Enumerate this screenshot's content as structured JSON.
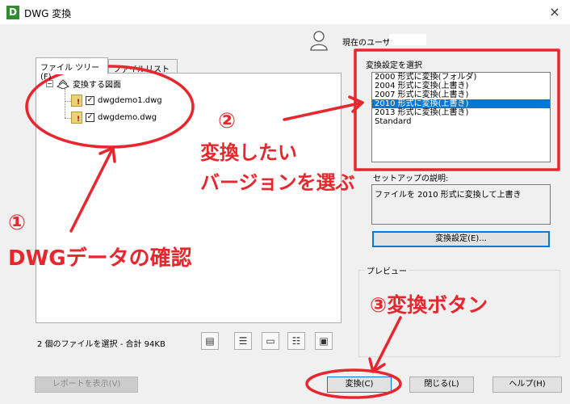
{
  "window": {
    "app_icon_letter": "D",
    "title": "DWG 変換",
    "close_glyph": "×"
  },
  "user": {
    "label": "現在のユーザ:",
    "value": ""
  },
  "tabs": [
    {
      "label": "ファイル ツリー(F)"
    },
    {
      "label": "ファイルリスト(B)"
    }
  ],
  "tree": {
    "root_label": "変換する図面",
    "files": [
      {
        "name": "dwgdemo1.dwg",
        "checked": true
      },
      {
        "name": "dwgdemo.dwg",
        "checked": true
      }
    ]
  },
  "status": {
    "text": "2 個のファイルを選択 - 合計 94KB"
  },
  "toolbar_icons": [
    "add-file-icon",
    "new-list-icon",
    "open-list-icon",
    "append-list-icon",
    "save-list-icon"
  ],
  "settings": {
    "group_label": "変換設定を選択",
    "items": [
      "2000 形式に変換(フォルダ)",
      "2004 形式に変換(上書き)",
      "2007 形式に変換(上書き)",
      "2010 形式に変換(上書き)",
      "2013 形式に変換(上書き)",
      "Standard"
    ],
    "selected_index": 3
  },
  "description": {
    "label": "セットアップの説明:",
    "text": "ファイルを 2010 形式に変換して上書き"
  },
  "buttons": {
    "settings": "変換設定(E)...",
    "report": "レポートを表示(V)",
    "convert": "変換(C)",
    "close": "閉じる(L)",
    "help": "ヘルプ(H)"
  },
  "preview": {
    "label": "プレビュー"
  },
  "annotations": {
    "step1_number": "①",
    "step1_text": "DWGデータの確認",
    "step2_number": "②",
    "step2_line1": "変換したい",
    "step2_line2": "バージョンを選ぶ",
    "step3_text": "③変換ボタン"
  },
  "colors": {
    "accent": "#0078d7",
    "annotation": "#e8262e",
    "app_icon": "#2f8f2f"
  }
}
